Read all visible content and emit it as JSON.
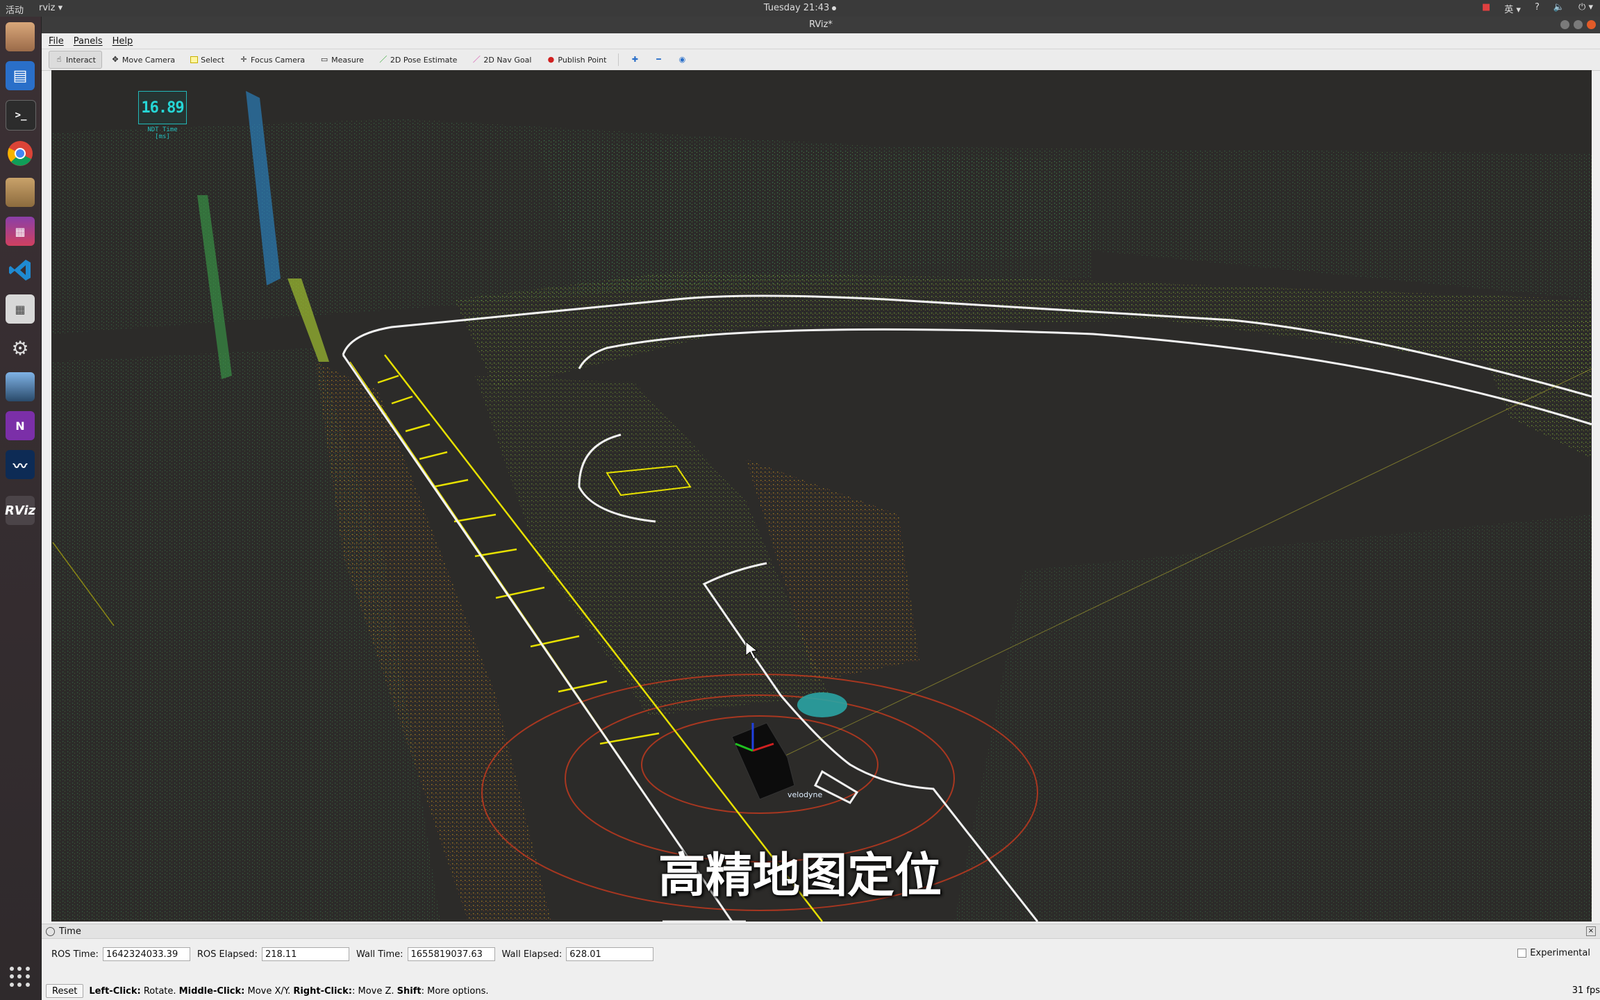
{
  "topbar": {
    "activities": "活动",
    "app_menu": "rviz ▾",
    "clock": "Tuesday 21:43",
    "input_method": "英 ▾",
    "help": "?",
    "volume": "🔈",
    "power": "⏻ ▾"
  },
  "window": {
    "title": "RViz*"
  },
  "menu": [
    "File",
    "Panels",
    "Help"
  ],
  "toolbar": {
    "interact": "Interact",
    "move_camera": "Move Camera",
    "select": "Select",
    "focus_camera": "Focus Camera",
    "measure": "Measure",
    "pose_estimate": "2D Pose Estimate",
    "nav_goal": "2D Nav Goal",
    "publish_point": "Publish Point"
  },
  "overlay": {
    "ndt_value": "16.89",
    "ndt_caption": "NDT Time [ms]",
    "frame_label": "velodyne",
    "subtitle": "高精地图定位"
  },
  "time_panel": {
    "title": "Time",
    "ros_time_label": "ROS Time:",
    "ros_time": "1642324033.39",
    "ros_elapsed_label": "ROS Elapsed:",
    "ros_elapsed": "218.11",
    "wall_time_label": "Wall Time:",
    "wall_time": "1655819037.63",
    "wall_elapsed_label": "Wall Elapsed:",
    "wall_elapsed": "628.01",
    "experimental": "Experimental"
  },
  "status": {
    "reset": "Reset",
    "hint_left": "Left-Click:",
    "hint_left_text": " Rotate. ",
    "hint_middle": "Middle-Click:",
    "hint_middle_text": " Move X/Y. ",
    "hint_right": "Right-Click:",
    "hint_right_text": ": Move Z. ",
    "hint_shift": "Shift",
    "hint_shift_text": ": More options.",
    "fps": "31 fps"
  },
  "dock": {
    "rviz_label": "RViz",
    "onenote_label": "N"
  }
}
